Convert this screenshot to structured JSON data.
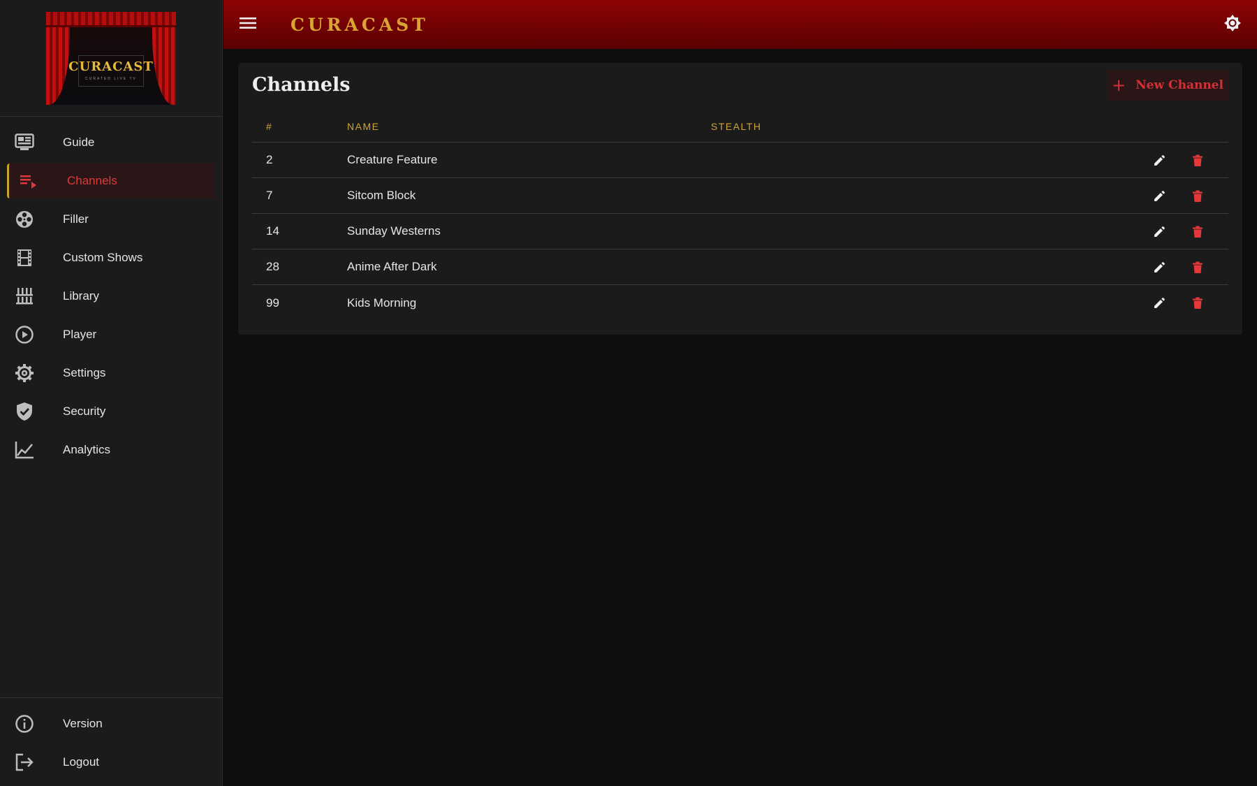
{
  "app": {
    "brand": "CURACAST",
    "logo_title": "CURACAST",
    "logo_subtitle": "CURATED LIVE TV"
  },
  "sidebar": {
    "items": [
      {
        "label": "Guide",
        "icon": "guide-icon"
      },
      {
        "label": "Channels",
        "icon": "channels-icon",
        "active": true
      },
      {
        "label": "Filler",
        "icon": "film-reel-icon"
      },
      {
        "label": "Custom Shows",
        "icon": "film-strip-icon"
      },
      {
        "label": "Library",
        "icon": "library-icon"
      },
      {
        "label": "Player",
        "icon": "play-circle-icon"
      },
      {
        "label": "Settings",
        "icon": "gear-icon"
      },
      {
        "label": "Security",
        "icon": "shield-icon"
      },
      {
        "label": "Analytics",
        "icon": "line-chart-icon"
      }
    ],
    "bottom_items": [
      {
        "label": "Version",
        "icon": "info-icon"
      },
      {
        "label": "Logout",
        "icon": "logout-icon"
      }
    ]
  },
  "main": {
    "title": "Channels",
    "new_button_label": "New Channel",
    "columns": [
      "#",
      "NAME",
      "STEALTH"
    ],
    "rows": [
      {
        "number": "2",
        "name": "Creature Feature",
        "stealth": ""
      },
      {
        "number": "7",
        "name": "Sitcom Block",
        "stealth": ""
      },
      {
        "number": "14",
        "name": "Sunday Westerns",
        "stealth": ""
      },
      {
        "number": "28",
        "name": "Anime After Dark",
        "stealth": ""
      },
      {
        "number": "99",
        "name": "Kids Morning",
        "stealth": ""
      }
    ]
  },
  "colors": {
    "accent_red": "#e0393c",
    "accent_gold": "#cfa335",
    "topbar_red": "#8e0404",
    "background": "#0e0e0e",
    "panel": "#1b1b1b"
  }
}
